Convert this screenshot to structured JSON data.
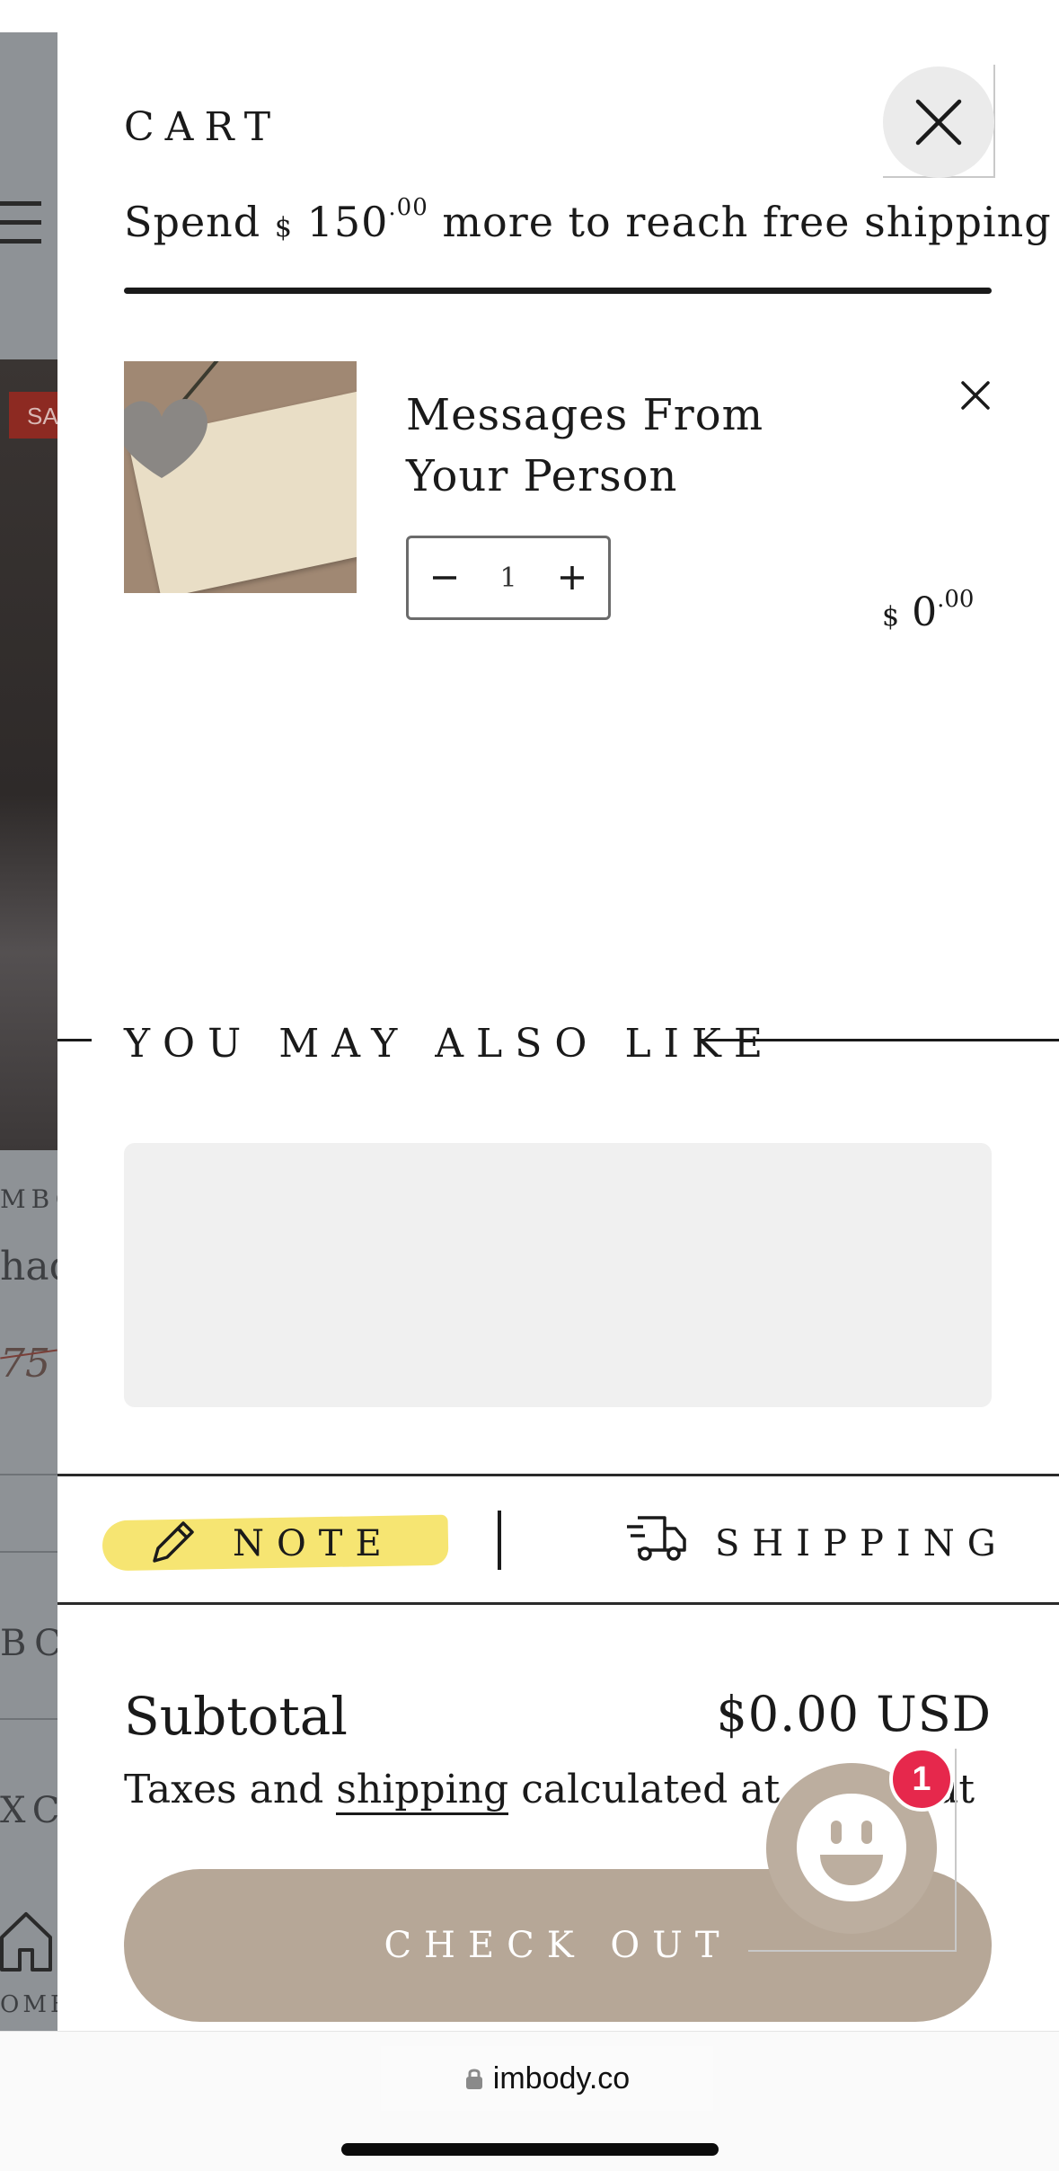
{
  "background_page": {
    "sale_badge": "SA",
    "brand_fragment": "MBO",
    "title_fragment": "had",
    "price_fragment": "75",
    "nav_fragment_1": "BC",
    "nav_fragment_2": "XC",
    "home_label_fragment": "OME"
  },
  "cart": {
    "title": "CART",
    "shipping_message": {
      "prefix": "Spend ",
      "currency": "$",
      "amount": "150",
      "cents": ".00",
      "suffix": " more to reach free shipping"
    },
    "free_shipping_progress": 1.0,
    "items": [
      {
        "name": "Messages From Your Person",
        "quantity": "1",
        "price_currency": "$",
        "price_amount": "0",
        "price_cents": ".00"
      }
    ],
    "you_may_also_like": "YOU MAY ALSO LIKE",
    "tabs": {
      "note": "NOTE",
      "shipping": "SHIPPING"
    },
    "subtotal_label": "Subtotal",
    "subtotal_value": "$0.00 USD",
    "tax_note": {
      "before": "Taxes and ",
      "link": "shipping",
      "after": " calculated at checkout"
    },
    "checkout_label": "CHECK OUT"
  },
  "chat": {
    "badge_count": "1",
    "icon": "smiley-chat-icon"
  },
  "browser": {
    "url": "imbody.co",
    "icon": "lock-icon"
  },
  "colors": {
    "checkout_bg": "#b6a797",
    "note_highlight": "#f6e46a",
    "badge_red": "#e6284c",
    "overlay_gray": "#8e9296"
  }
}
